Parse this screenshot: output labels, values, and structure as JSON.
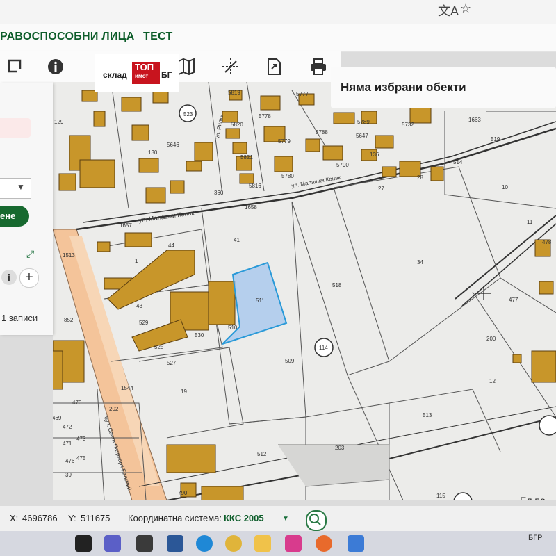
{
  "nav": {
    "item_legal": "РАВОСПОСОБНИ ЛИЦА",
    "item_test": "ТЕСТ"
  },
  "logo": {
    "left": "склад",
    "top": "ТОП",
    "imot": "имот",
    "right": "БГ"
  },
  "selection": {
    "text": "Няма избрани обекти"
  },
  "side_panel": {
    "button_label": "ене",
    "records_label": "1 записи"
  },
  "coords": {
    "x_label": "X:",
    "x_value": "4696786",
    "y_label": "Y:",
    "y_value": "511675",
    "system_label": "Координатна система:",
    "system_value": "ККС 2005"
  },
  "map": {
    "street_1": "ул. Малашки Конак",
    "street_2": "ул. Малашки Конак",
    "street_3": "ул. Рилка",
    "street_4": "бул. Свети Патриарх Евтимий",
    "labels": [
      "523",
      "5819",
      "5777",
      "5778",
      "5820",
      "5788",
      "5789",
      "5732",
      "1663",
      "519",
      "129",
      "130",
      "5646",
      "5779",
      "5647",
      "5790",
      "5821",
      "5780",
      "136",
      "514",
      "360",
      "5816",
      "27",
      "28",
      "10",
      "1658",
      "41",
      "1657",
      "11",
      "1513",
      "44",
      "1",
      "34",
      "478",
      "518",
      "511",
      "43",
      "477",
      "852",
      "529",
      "510",
      "530",
      "114",
      "200",
      "525",
      "527",
      "509",
      "1544",
      "19",
      "12",
      "513",
      "470",
      "202",
      "469",
      "472",
      "471",
      "473",
      "476",
      "475",
      "39",
      "512",
      "203",
      "790",
      "115"
    ],
    "place_label": "Ел.по"
  },
  "taskbar": {
    "language": "БГР"
  }
}
